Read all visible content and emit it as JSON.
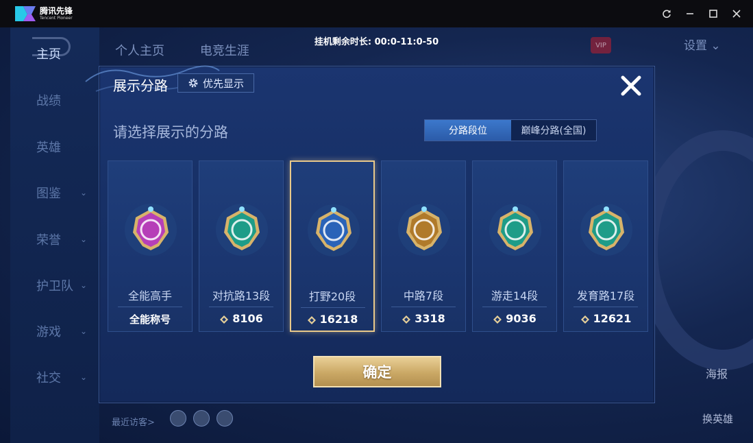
{
  "titlebar": {
    "brand_cn": "腾讯先锋",
    "brand_en": "Tencent Pioneer",
    "idle_timer": "挂机剩余时长: 00:0-11:0-50"
  },
  "nav": {
    "items": [
      {
        "label": "主页",
        "active": true,
        "chevron": false
      },
      {
        "label": "战绩",
        "active": false,
        "chevron": false
      },
      {
        "label": "英雄",
        "active": false,
        "chevron": false
      },
      {
        "label": "图鉴",
        "active": false,
        "chevron": true
      },
      {
        "label": "荣誉",
        "active": false,
        "chevron": true
      },
      {
        "label": "护卫队",
        "active": false,
        "chevron": true
      },
      {
        "label": "游戏",
        "active": false,
        "chevron": true
      },
      {
        "label": "社交",
        "active": false,
        "chevron": true
      }
    ]
  },
  "background": {
    "tabs": [
      "个人主页",
      "电竞生涯"
    ],
    "vip": "VIP",
    "settings": "设置",
    "sea": "海报",
    "swap_hero": "换英雄",
    "recent_visitors": "最近访客>"
  },
  "modal": {
    "title": "展示分路",
    "priority_label": "优先显示",
    "subheading": "请选择展示的分路",
    "toggle": {
      "left": "分路段位",
      "right": "巅峰分路(全国)",
      "selected": "left"
    },
    "cards": [
      {
        "label": "全能高手",
        "value": "全能称号",
        "has_points_icon": false,
        "selected": false,
        "badge": "all-round",
        "badge_color": "#b63fb8"
      },
      {
        "label": "对抗路13段",
        "value": "8106",
        "has_points_icon": true,
        "selected": false,
        "badge": "clash-lane",
        "badge_color": "#1e9c88"
      },
      {
        "label": "打野20段",
        "value": "16218",
        "has_points_icon": true,
        "selected": true,
        "badge": "jungle",
        "badge_color": "#2a63b8"
      },
      {
        "label": "中路7段",
        "value": "3318",
        "has_points_icon": true,
        "selected": false,
        "badge": "mid-lane",
        "badge_color": "#b07a2a"
      },
      {
        "label": "游走14段",
        "value": "9036",
        "has_points_icon": true,
        "selected": false,
        "badge": "roam",
        "badge_color": "#1e9c88"
      },
      {
        "label": "发育路17段",
        "value": "12621",
        "has_points_icon": true,
        "selected": false,
        "badge": "farm-lane",
        "badge_color": "#1e9c88"
      }
    ],
    "confirm_label": "确定"
  },
  "colors": {
    "accent_blue": "#3c78cc",
    "gold": "#caa865",
    "modal_bg": "#1b3570"
  }
}
